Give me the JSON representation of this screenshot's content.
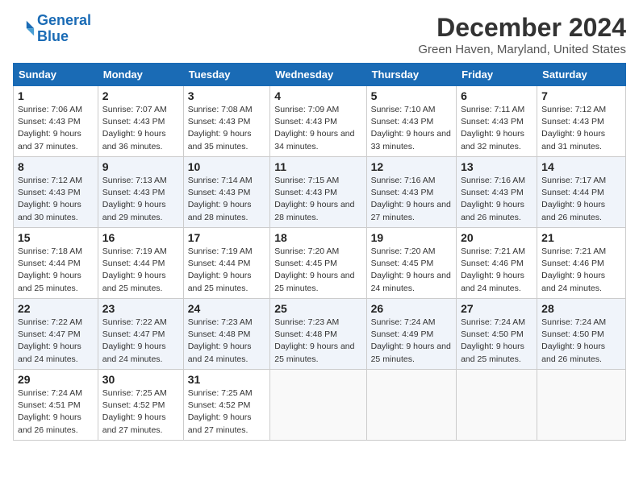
{
  "header": {
    "logo_line1": "General",
    "logo_line2": "Blue",
    "month_title": "December 2024",
    "location": "Green Haven, Maryland, United States"
  },
  "days_of_week": [
    "Sunday",
    "Monday",
    "Tuesday",
    "Wednesday",
    "Thursday",
    "Friday",
    "Saturday"
  ],
  "weeks": [
    [
      {
        "day": "1",
        "sunrise": "7:06 AM",
        "sunset": "4:43 PM",
        "daylight": "9 hours and 37 minutes."
      },
      {
        "day": "2",
        "sunrise": "7:07 AM",
        "sunset": "4:43 PM",
        "daylight": "9 hours and 36 minutes."
      },
      {
        "day": "3",
        "sunrise": "7:08 AM",
        "sunset": "4:43 PM",
        "daylight": "9 hours and 35 minutes."
      },
      {
        "day": "4",
        "sunrise": "7:09 AM",
        "sunset": "4:43 PM",
        "daylight": "9 hours and 34 minutes."
      },
      {
        "day": "5",
        "sunrise": "7:10 AM",
        "sunset": "4:43 PM",
        "daylight": "9 hours and 33 minutes."
      },
      {
        "day": "6",
        "sunrise": "7:11 AM",
        "sunset": "4:43 PM",
        "daylight": "9 hours and 32 minutes."
      },
      {
        "day": "7",
        "sunrise": "7:12 AM",
        "sunset": "4:43 PM",
        "daylight": "9 hours and 31 minutes."
      }
    ],
    [
      {
        "day": "8",
        "sunrise": "7:12 AM",
        "sunset": "4:43 PM",
        "daylight": "9 hours and 30 minutes."
      },
      {
        "day": "9",
        "sunrise": "7:13 AM",
        "sunset": "4:43 PM",
        "daylight": "9 hours and 29 minutes."
      },
      {
        "day": "10",
        "sunrise": "7:14 AM",
        "sunset": "4:43 PM",
        "daylight": "9 hours and 28 minutes."
      },
      {
        "day": "11",
        "sunrise": "7:15 AM",
        "sunset": "4:43 PM",
        "daylight": "9 hours and 28 minutes."
      },
      {
        "day": "12",
        "sunrise": "7:16 AM",
        "sunset": "4:43 PM",
        "daylight": "9 hours and 27 minutes."
      },
      {
        "day": "13",
        "sunrise": "7:16 AM",
        "sunset": "4:43 PM",
        "daylight": "9 hours and 26 minutes."
      },
      {
        "day": "14",
        "sunrise": "7:17 AM",
        "sunset": "4:44 PM",
        "daylight": "9 hours and 26 minutes."
      }
    ],
    [
      {
        "day": "15",
        "sunrise": "7:18 AM",
        "sunset": "4:44 PM",
        "daylight": "9 hours and 25 minutes."
      },
      {
        "day": "16",
        "sunrise": "7:19 AM",
        "sunset": "4:44 PM",
        "daylight": "9 hours and 25 minutes."
      },
      {
        "day": "17",
        "sunrise": "7:19 AM",
        "sunset": "4:44 PM",
        "daylight": "9 hours and 25 minutes."
      },
      {
        "day": "18",
        "sunrise": "7:20 AM",
        "sunset": "4:45 PM",
        "daylight": "9 hours and 25 minutes."
      },
      {
        "day": "19",
        "sunrise": "7:20 AM",
        "sunset": "4:45 PM",
        "daylight": "9 hours and 24 minutes."
      },
      {
        "day": "20",
        "sunrise": "7:21 AM",
        "sunset": "4:46 PM",
        "daylight": "9 hours and 24 minutes."
      },
      {
        "day": "21",
        "sunrise": "7:21 AM",
        "sunset": "4:46 PM",
        "daylight": "9 hours and 24 minutes."
      }
    ],
    [
      {
        "day": "22",
        "sunrise": "7:22 AM",
        "sunset": "4:47 PM",
        "daylight": "9 hours and 24 minutes."
      },
      {
        "day": "23",
        "sunrise": "7:22 AM",
        "sunset": "4:47 PM",
        "daylight": "9 hours and 24 minutes."
      },
      {
        "day": "24",
        "sunrise": "7:23 AM",
        "sunset": "4:48 PM",
        "daylight": "9 hours and 24 minutes."
      },
      {
        "day": "25",
        "sunrise": "7:23 AM",
        "sunset": "4:48 PM",
        "daylight": "9 hours and 25 minutes."
      },
      {
        "day": "26",
        "sunrise": "7:24 AM",
        "sunset": "4:49 PM",
        "daylight": "9 hours and 25 minutes."
      },
      {
        "day": "27",
        "sunrise": "7:24 AM",
        "sunset": "4:50 PM",
        "daylight": "9 hours and 25 minutes."
      },
      {
        "day": "28",
        "sunrise": "7:24 AM",
        "sunset": "4:50 PM",
        "daylight": "9 hours and 26 minutes."
      }
    ],
    [
      {
        "day": "29",
        "sunrise": "7:24 AM",
        "sunset": "4:51 PM",
        "daylight": "9 hours and 26 minutes."
      },
      {
        "day": "30",
        "sunrise": "7:25 AM",
        "sunset": "4:52 PM",
        "daylight": "9 hours and 27 minutes."
      },
      {
        "day": "31",
        "sunrise": "7:25 AM",
        "sunset": "4:52 PM",
        "daylight": "9 hours and 27 minutes."
      },
      null,
      null,
      null,
      null
    ]
  ]
}
